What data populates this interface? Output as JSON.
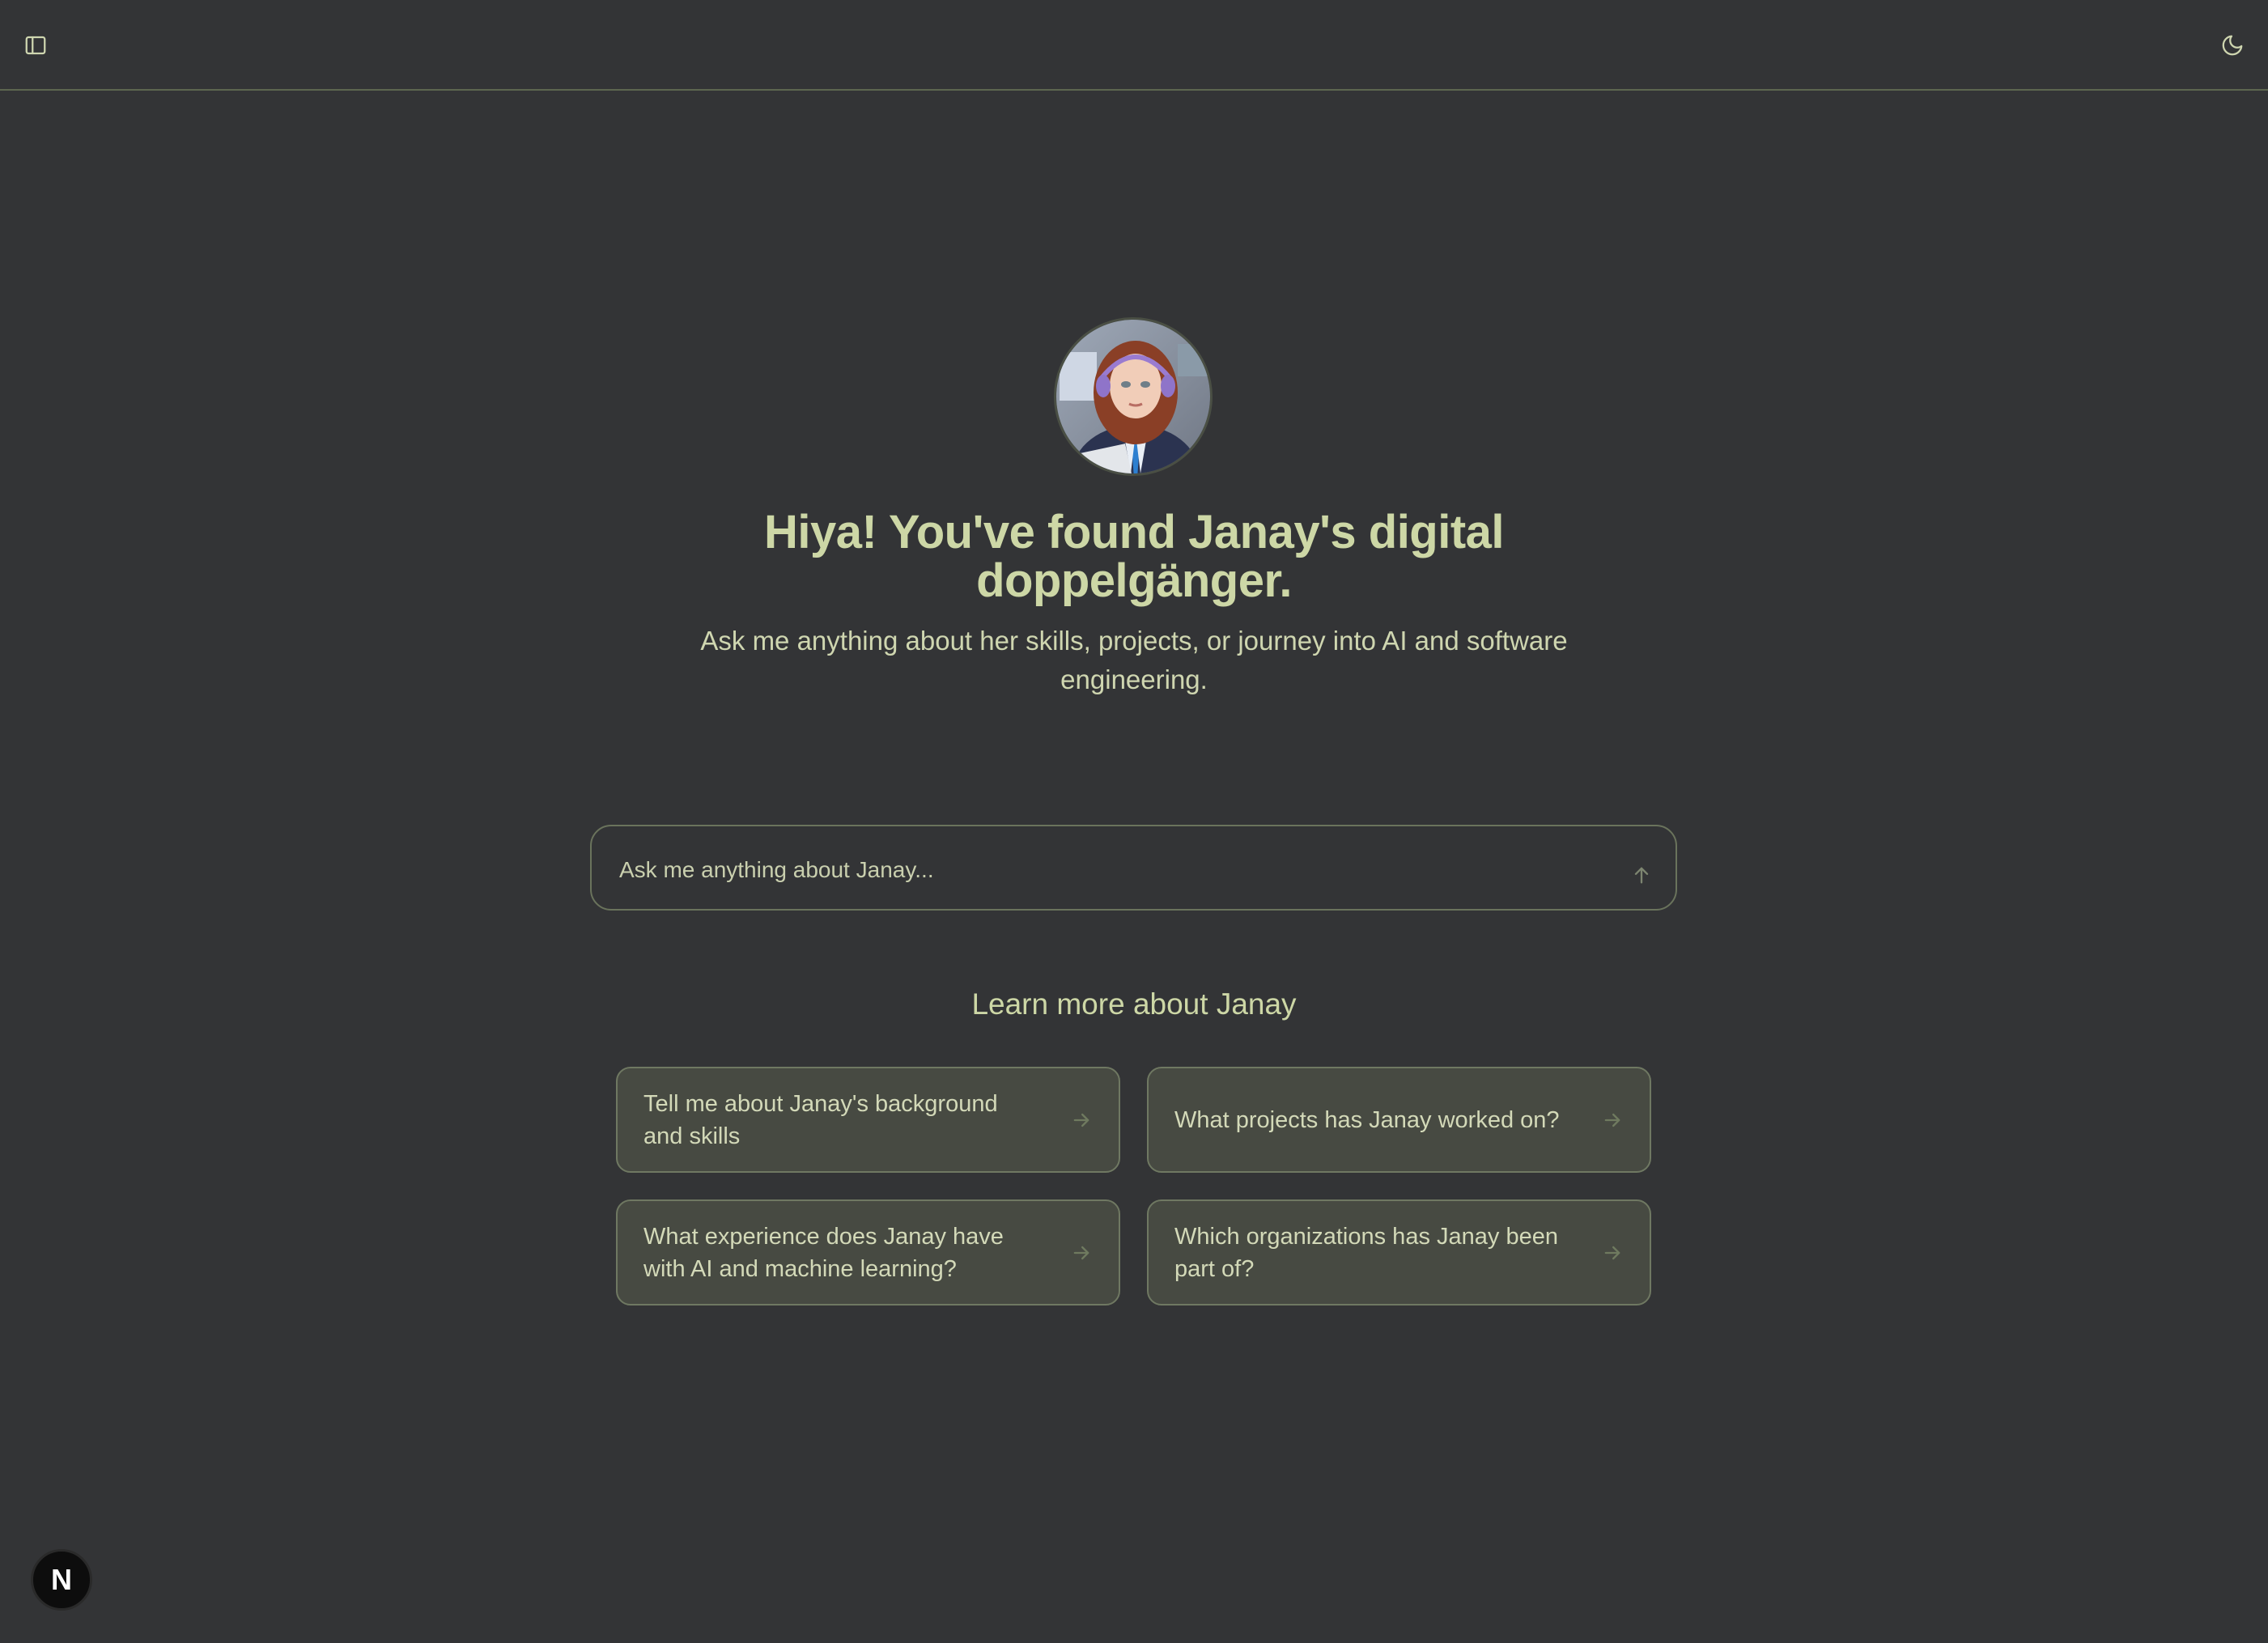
{
  "header": {
    "sidebar_toggle_icon": "sidebar-panel-icon",
    "theme_toggle_icon": "moon-icon"
  },
  "hero": {
    "title_line1": "Hiya! You've found Janay's digital",
    "title_line2": "doppelgänger.",
    "subtitle_line1": "Ask me anything about her skills, projects, or journey into AI and software",
    "subtitle_line2": "engineering."
  },
  "chat": {
    "placeholder": "Ask me anything about Janay...",
    "send_icon": "arrow-up-icon"
  },
  "suggestions": {
    "heading": "Learn more about Janay",
    "items": [
      {
        "label": "Tell me about Janay's background and skills"
      },
      {
        "label": "What projects has Janay worked on?"
      },
      {
        "label": "What experience does Janay have with AI and machine learning?"
      },
      {
        "label": "Which organizations has Janay been part of?"
      }
    ]
  },
  "badge": {
    "label": "N"
  },
  "colors": {
    "background": "#333436",
    "accent_text": "#cdd7a6",
    "card_bg": "#474a42",
    "border": "#6f7862"
  }
}
